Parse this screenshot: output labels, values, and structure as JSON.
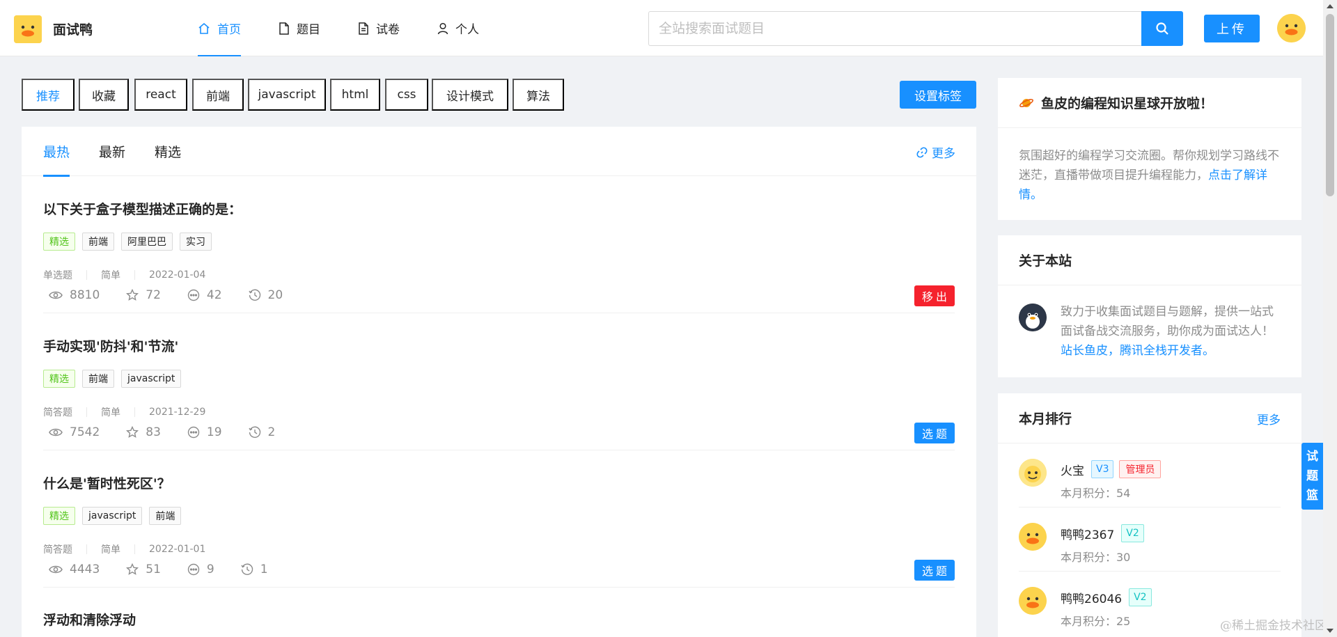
{
  "header": {
    "logo_text": "面试鸭",
    "nav": [
      {
        "label": "首页",
        "icon": "home-icon",
        "active": true
      },
      {
        "label": "题目",
        "icon": "file-icon"
      },
      {
        "label": "试卷",
        "icon": "file-text-icon"
      },
      {
        "label": "个人",
        "icon": "user-icon"
      }
    ],
    "search_placeholder": "全站搜索面试题目",
    "upload_label": "上传"
  },
  "tag_bar": {
    "tags": [
      "推荐",
      "收藏",
      "react",
      "前端",
      "javascript",
      "html",
      "css",
      "设计模式",
      "算法"
    ],
    "active_index": 0,
    "set_tags_label": "设置标签"
  },
  "list": {
    "tabs": [
      "最热",
      "最新",
      "精选"
    ],
    "active_tab": 0,
    "more_label": "更多",
    "questions": [
      {
        "title": "以下关于盒子模型描述正确的是：",
        "tags": [
          {
            "label": "精选",
            "good": true
          },
          {
            "label": "前端"
          },
          {
            "label": "阿里巴巴"
          },
          {
            "label": "实习"
          }
        ],
        "type": "单选题",
        "difficulty": "简单",
        "date": "2022-01-04",
        "views": "8810",
        "stars": "72",
        "comments": "42",
        "history": "20",
        "action": "移出",
        "action_kind": "remove"
      },
      {
        "title": "手动实现'防抖'和'节流'",
        "tags": [
          {
            "label": "精选",
            "good": true
          },
          {
            "label": "前端"
          },
          {
            "label": "javascript"
          }
        ],
        "type": "简答题",
        "difficulty": "简单",
        "date": "2021-12-29",
        "views": "7542",
        "stars": "83",
        "comments": "19",
        "history": "2",
        "action": "选题",
        "action_kind": "select"
      },
      {
        "title": "什么是'暂时性死区'？",
        "tags": [
          {
            "label": "精选",
            "good": true
          },
          {
            "label": "javascript"
          },
          {
            "label": "前端"
          }
        ],
        "type": "简答题",
        "difficulty": "简单",
        "date": "2022-01-01",
        "views": "4443",
        "stars": "51",
        "comments": "9",
        "history": "1",
        "action": "选题",
        "action_kind": "select"
      }
    ],
    "next_title": "浮动和清除浮动"
  },
  "sidebar": {
    "planet": {
      "title": "鱼皮的编程知识星球开放啦！",
      "text": "氛围超好的编程学习交流圈。帮你规划学习路线不迷茫，直播带做项目提升编程能力，",
      "link": "点击了解详情。"
    },
    "about": {
      "title": "关于本站",
      "text": "致力于收集面试题目与题解，提供一站式面试备战交流服务，助你成为面试达人！",
      "link": "站长鱼皮，腾讯全栈开发者。"
    },
    "rank": {
      "title": "本月排行",
      "more_label": "更多",
      "items": [
        {
          "name": "火宝",
          "level": "V3",
          "admin": "管理员",
          "score": "本月积分：54"
        },
        {
          "name": "鸭鸭2367",
          "level": "V2",
          "score": "本月积分：30"
        },
        {
          "name": "鸭鸭26046",
          "level": "V2",
          "score": "本月积分：25"
        }
      ]
    }
  },
  "basket": {
    "chars": [
      "试",
      "题",
      "篮"
    ]
  },
  "watermark": "@稀土掘金技术社区",
  "colors": {
    "primary": "#1890ff",
    "danger": "#f5222d",
    "success": "#52c41a",
    "bg": "#f0f2f5"
  }
}
